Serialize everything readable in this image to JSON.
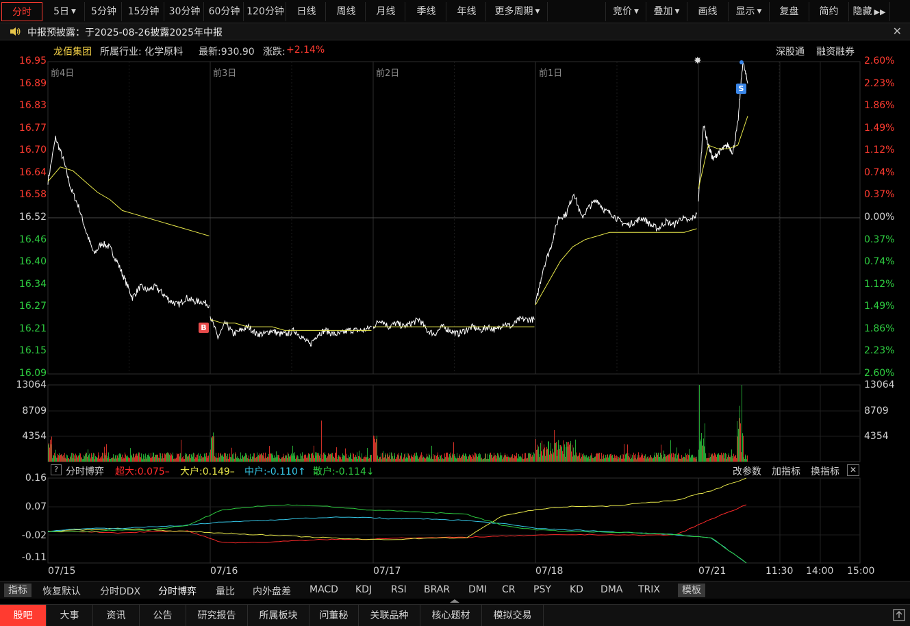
{
  "toolbar": {
    "periods": [
      "分时",
      "5日",
      "5分钟",
      "15分钟",
      "30分钟",
      "60分钟",
      "120分钟",
      "日线",
      "周线",
      "月线",
      "季线",
      "年线",
      "更多周期"
    ],
    "right": [
      "竞价",
      "叠加",
      "画线",
      "显示",
      "复盘",
      "简约",
      "隐藏"
    ]
  },
  "notice": {
    "text": "中报预披露：于2025-08-26披露2025年中报"
  },
  "stock": {
    "name": "龙佰集团",
    "industry": "所属行业: 化学原料",
    "latest": "最新:930.90",
    "change_label": "涨跌:",
    "change_value": "+2.14%",
    "tags": [
      "深股通",
      "融资融券"
    ]
  },
  "day_labels": [
    "前4日",
    "前3日",
    "前2日",
    "前1日"
  ],
  "markers": {
    "buy": "B",
    "sell": "S"
  },
  "colors": {
    "up": "#ff3b30",
    "down": "#2ecc40",
    "price": "#ffffff",
    "avg": "#e8e84a",
    "grid": "#2e2e2e",
    "super": "#ff2a2a",
    "large": "#e8e84a",
    "mid": "#35c8e8",
    "small": "#2ecc40"
  },
  "chart_data": [
    {
      "type": "line",
      "title": "",
      "y_left": [
        "16.95",
        "16.89",
        "16.83",
        "16.77",
        "16.70",
        "16.64",
        "16.58",
        "16.52",
        "16.46",
        "16.40",
        "16.34",
        "16.27",
        "16.21",
        "16.15",
        "16.09"
      ],
      "y_right": [
        "2.60%",
        "2.23%",
        "1.86%",
        "1.49%",
        "1.12%",
        "0.74%",
        "0.37%",
        "0.00%",
        "0.37%",
        "0.74%",
        "1.12%",
        "1.49%",
        "1.86%",
        "2.23%",
        "2.60%"
      ],
      "ylim": [
        16.09,
        16.95
      ],
      "prev_close": 16.52,
      "days": [
        {
          "price": [
            16.62,
            16.74,
            16.68,
            16.6,
            16.55,
            16.48,
            16.42,
            16.45,
            16.44,
            16.4,
            16.35,
            16.3,
            16.33,
            16.32,
            16.33,
            16.31,
            16.29,
            16.28,
            16.3,
            16.29,
            16.29,
            16.28
          ],
          "avg": [
            16.62,
            16.66,
            16.65,
            16.62,
            16.59,
            16.57,
            16.54,
            16.53,
            16.52,
            16.51,
            16.5,
            16.49,
            16.48,
            16.47
          ]
        },
        {
          "price": [
            16.25,
            16.19,
            16.23,
            16.2,
            16.21,
            16.22,
            16.2,
            16.2,
            16.21,
            16.2,
            16.2,
            16.21,
            16.19,
            16.17,
            16.2,
            16.21,
            16.2,
            16.2,
            16.21,
            16.21,
            16.21,
            16.22
          ],
          "avg": [
            16.24,
            16.23,
            16.23,
            16.22,
            16.22,
            16.22,
            16.21,
            16.21,
            16.21,
            16.21,
            16.21,
            16.21,
            16.21,
            16.21
          ]
        },
        {
          "price": [
            16.22,
            16.24,
            16.22,
            16.23,
            16.22,
            16.23,
            16.24,
            16.21,
            16.2,
            16.22,
            16.21,
            16.2,
            16.21,
            16.22,
            16.21,
            16.22,
            16.21,
            16.23,
            16.22,
            16.24,
            16.24,
            16.24
          ],
          "avg": [
            16.22,
            16.22,
            16.22,
            16.22,
            16.22,
            16.22,
            16.22,
            16.22,
            16.22,
            16.22,
            16.22,
            16.22,
            16.22,
            16.22
          ]
        },
        {
          "price": [
            16.28,
            16.38,
            16.44,
            16.52,
            16.53,
            16.59,
            16.52,
            16.55,
            16.57,
            16.54,
            16.53,
            16.51,
            16.5,
            16.51,
            16.52,
            16.5,
            16.49,
            16.51,
            16.5,
            16.52,
            16.51,
            16.53
          ],
          "avg": [
            16.28,
            16.34,
            16.4,
            16.44,
            16.46,
            16.47,
            16.48,
            16.48,
            16.48,
            16.48,
            16.48,
            16.48,
            16.48,
            16.49
          ]
        },
        {
          "price": [
            16.57,
            16.78,
            16.72,
            16.68,
            16.7,
            16.71,
            16.72,
            16.7,
            16.78,
            16.95,
            16.89
          ],
          "avg": [
            16.6,
            16.72,
            16.71,
            16.71,
            16.72,
            16.8
          ]
        }
      ]
    },
    {
      "type": "bar",
      "title": "",
      "y_labels": [
        "13064",
        "8709",
        "4354"
      ],
      "ylim": [
        0,
        13064
      ]
    },
    {
      "type": "line",
      "title": "",
      "y_labels": [
        "0.16",
        "0.07",
        "-0.02",
        "-0.11"
      ],
      "ylim": [
        -0.11,
        0.16
      ],
      "legend": {
        "name": "分时博弈",
        "super": "超大:0.075",
        "large": "大户:0.149",
        "mid": "中户:-0.110",
        "small": "散户:-0.114"
      },
      "series": [
        {
          "key": "super",
          "values": [
            -0.01,
            -0.01,
            -0.015,
            -0.01,
            -0.008,
            -0.045,
            -0.045,
            -0.04,
            -0.035,
            -0.035,
            -0.03,
            -0.03,
            -0.028,
            -0.025,
            -0.022,
            -0.02,
            -0.02,
            -0.022,
            -0.02,
            0.03,
            0.075
          ]
        },
        {
          "key": "large",
          "values": [
            -0.01,
            -0.005,
            0.0,
            -0.005,
            -0.01,
            -0.015,
            -0.02,
            -0.025,
            -0.03,
            -0.035,
            -0.035,
            -0.03,
            -0.03,
            0.04,
            0.06,
            0.07,
            0.07,
            0.08,
            0.09,
            0.12,
            0.16
          ]
        },
        {
          "key": "mid",
          "values": [
            -0.01,
            0.0,
            0.0,
            0.005,
            0.01,
            0.02,
            0.025,
            0.03,
            0.035,
            0.035,
            0.03,
            0.03,
            0.025,
            0.015,
            0.0,
            -0.005,
            -0.01,
            -0.015,
            -0.02,
            -0.03,
            -0.11
          ]
        },
        {
          "key": "small",
          "values": [
            -0.01,
            -0.01,
            -0.005,
            -0.005,
            0.01,
            0.06,
            0.07,
            0.075,
            0.07,
            0.06,
            0.055,
            0.05,
            0.045,
            0.01,
            -0.005,
            -0.01,
            -0.012,
            -0.015,
            -0.02,
            -0.03,
            -0.11
          ]
        }
      ]
    }
  ],
  "x_labels": [
    "07/15",
    "07/16",
    "07/17",
    "07/18",
    "07/21",
    "11:30",
    "14:00",
    "15:00"
  ],
  "indicator_actions": [
    "改参数",
    "加指标",
    "换指标"
  ],
  "indicator_tabs": [
    "指标",
    "恢复默认",
    "分时DDX",
    "分时博弈",
    "量比",
    "内外盘差",
    "MACD",
    "KDJ",
    "RSI",
    "BRAR",
    "DMI",
    "CR",
    "PSY",
    "KD",
    "DMA",
    "TRIX",
    "模板"
  ],
  "app_tabs": [
    "股吧",
    "大事",
    "资讯",
    "公告",
    "研究报告",
    "所属板块",
    "问董秘",
    "关联品种",
    "核心题材",
    "模拟交易"
  ]
}
